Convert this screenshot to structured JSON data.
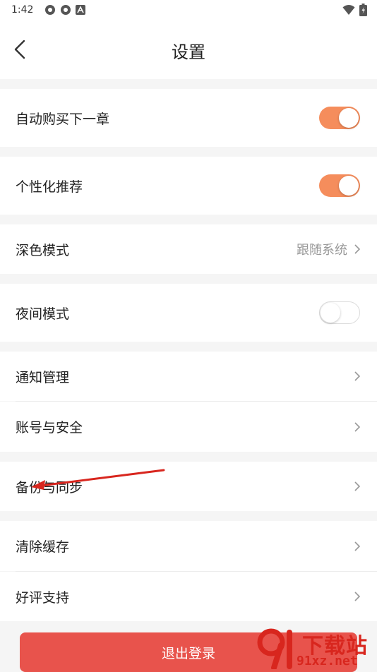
{
  "status_bar": {
    "time": "1:42",
    "icons": [
      "app-icon-1",
      "app-icon-2",
      "a-letter-icon"
    ],
    "right_icons": [
      "wifi-icon",
      "battery-icon"
    ]
  },
  "header": {
    "title": "设置",
    "back_icon": "chevron-left-icon"
  },
  "settings": {
    "auto_buy": {
      "label": "自动购买下一章",
      "on": true
    },
    "personalized": {
      "label": "个性化推荐",
      "on": true
    },
    "dark_mode": {
      "label": "深色模式",
      "value": "跟随系统"
    },
    "night_mode": {
      "label": "夜间模式",
      "on": false
    },
    "notifications": {
      "label": "通知管理"
    },
    "account_security": {
      "label": "账号与安全"
    },
    "backup_sync": {
      "label": "备份与同步"
    },
    "clear_cache": {
      "label": "清除缓存"
    },
    "rate_support": {
      "label": "好评支持"
    }
  },
  "logout": {
    "label": "退出登录"
  },
  "watermark": {
    "line1": "下载站",
    "line2": "91xz.net"
  },
  "colors": {
    "toggle_on": "#f58d5c",
    "logout_bg": "#e8534c",
    "annotation_arrow": "#d8261e"
  }
}
